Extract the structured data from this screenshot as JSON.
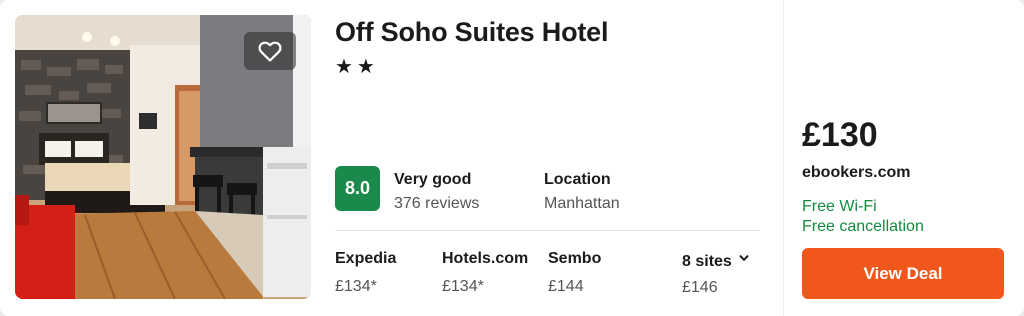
{
  "colors": {
    "score_green": "#1a8a4c",
    "feature_green": "#138a3e",
    "deal_orange": "#f1571a",
    "heart_white": "#ffffff"
  },
  "hotel": {
    "name": "Off Soho Suites Hotel",
    "stars": "★★",
    "favorite_icon": "heart-icon"
  },
  "rating": {
    "score": "8.0",
    "label": "Very good",
    "reviews": "376 reviews"
  },
  "location": {
    "label": "Location",
    "value": "Manhattan"
  },
  "sites": [
    {
      "name": "Expedia",
      "price": "£134*"
    },
    {
      "name": "Hotels.com",
      "price": "£134*"
    },
    {
      "name": "Sembo",
      "price": "£144"
    }
  ],
  "more_sites": {
    "label": "8 sites",
    "price": "£146",
    "icon": "chevron-down-icon"
  },
  "deal": {
    "price": "£130",
    "site": "ebookers.com",
    "features": [
      "Free Wi-Fi",
      "Free cancellation"
    ],
    "button_label": "View Deal"
  }
}
